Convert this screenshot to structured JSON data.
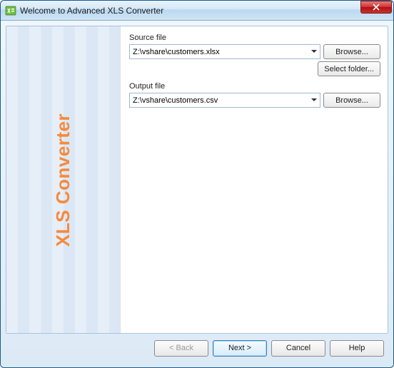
{
  "window": {
    "title": "Welcome to Advanced XLS Converter"
  },
  "sidebar": {
    "heading": "XLS Converter"
  },
  "form": {
    "source": {
      "label": "Source file",
      "value": "Z:\\vshare\\customers.xlsx",
      "browse": "Browse...",
      "select_folder": "Select folder..."
    },
    "output": {
      "label": "Output file",
      "value": "Z:\\vshare\\customers.csv",
      "browse": "Browse..."
    }
  },
  "wizard": {
    "back": "< Back",
    "next": "Next >",
    "cancel": "Cancel",
    "help": "Help"
  }
}
